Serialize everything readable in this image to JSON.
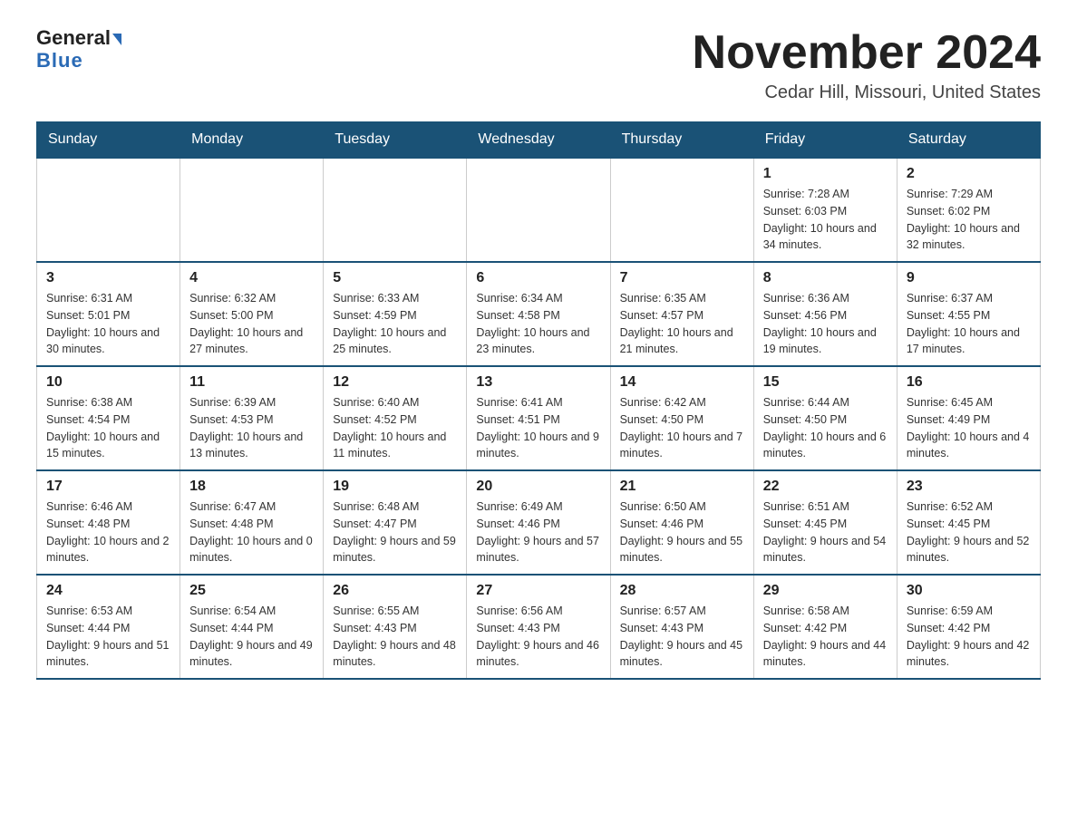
{
  "header": {
    "logo_line1": "General",
    "logo_line2": "Blue",
    "month_title": "November 2024",
    "location": "Cedar Hill, Missouri, United States"
  },
  "weekdays": [
    "Sunday",
    "Monday",
    "Tuesday",
    "Wednesday",
    "Thursday",
    "Friday",
    "Saturday"
  ],
  "weeks": [
    [
      {
        "day": "",
        "info": ""
      },
      {
        "day": "",
        "info": ""
      },
      {
        "day": "",
        "info": ""
      },
      {
        "day": "",
        "info": ""
      },
      {
        "day": "",
        "info": ""
      },
      {
        "day": "1",
        "info": "Sunrise: 7:28 AM\nSunset: 6:03 PM\nDaylight: 10 hours\nand 34 minutes."
      },
      {
        "day": "2",
        "info": "Sunrise: 7:29 AM\nSunset: 6:02 PM\nDaylight: 10 hours\nand 32 minutes."
      }
    ],
    [
      {
        "day": "3",
        "info": "Sunrise: 6:31 AM\nSunset: 5:01 PM\nDaylight: 10 hours\nand 30 minutes."
      },
      {
        "day": "4",
        "info": "Sunrise: 6:32 AM\nSunset: 5:00 PM\nDaylight: 10 hours\nand 27 minutes."
      },
      {
        "day": "5",
        "info": "Sunrise: 6:33 AM\nSunset: 4:59 PM\nDaylight: 10 hours\nand 25 minutes."
      },
      {
        "day": "6",
        "info": "Sunrise: 6:34 AM\nSunset: 4:58 PM\nDaylight: 10 hours\nand 23 minutes."
      },
      {
        "day": "7",
        "info": "Sunrise: 6:35 AM\nSunset: 4:57 PM\nDaylight: 10 hours\nand 21 minutes."
      },
      {
        "day": "8",
        "info": "Sunrise: 6:36 AM\nSunset: 4:56 PM\nDaylight: 10 hours\nand 19 minutes."
      },
      {
        "day": "9",
        "info": "Sunrise: 6:37 AM\nSunset: 4:55 PM\nDaylight: 10 hours\nand 17 minutes."
      }
    ],
    [
      {
        "day": "10",
        "info": "Sunrise: 6:38 AM\nSunset: 4:54 PM\nDaylight: 10 hours\nand 15 minutes."
      },
      {
        "day": "11",
        "info": "Sunrise: 6:39 AM\nSunset: 4:53 PM\nDaylight: 10 hours\nand 13 minutes."
      },
      {
        "day": "12",
        "info": "Sunrise: 6:40 AM\nSunset: 4:52 PM\nDaylight: 10 hours\nand 11 minutes."
      },
      {
        "day": "13",
        "info": "Sunrise: 6:41 AM\nSunset: 4:51 PM\nDaylight: 10 hours\nand 9 minutes."
      },
      {
        "day": "14",
        "info": "Sunrise: 6:42 AM\nSunset: 4:50 PM\nDaylight: 10 hours\nand 7 minutes."
      },
      {
        "day": "15",
        "info": "Sunrise: 6:44 AM\nSunset: 4:50 PM\nDaylight: 10 hours\nand 6 minutes."
      },
      {
        "day": "16",
        "info": "Sunrise: 6:45 AM\nSunset: 4:49 PM\nDaylight: 10 hours\nand 4 minutes."
      }
    ],
    [
      {
        "day": "17",
        "info": "Sunrise: 6:46 AM\nSunset: 4:48 PM\nDaylight: 10 hours\nand 2 minutes."
      },
      {
        "day": "18",
        "info": "Sunrise: 6:47 AM\nSunset: 4:48 PM\nDaylight: 10 hours\nand 0 minutes."
      },
      {
        "day": "19",
        "info": "Sunrise: 6:48 AM\nSunset: 4:47 PM\nDaylight: 9 hours\nand 59 minutes."
      },
      {
        "day": "20",
        "info": "Sunrise: 6:49 AM\nSunset: 4:46 PM\nDaylight: 9 hours\nand 57 minutes."
      },
      {
        "day": "21",
        "info": "Sunrise: 6:50 AM\nSunset: 4:46 PM\nDaylight: 9 hours\nand 55 minutes."
      },
      {
        "day": "22",
        "info": "Sunrise: 6:51 AM\nSunset: 4:45 PM\nDaylight: 9 hours\nand 54 minutes."
      },
      {
        "day": "23",
        "info": "Sunrise: 6:52 AM\nSunset: 4:45 PM\nDaylight: 9 hours\nand 52 minutes."
      }
    ],
    [
      {
        "day": "24",
        "info": "Sunrise: 6:53 AM\nSunset: 4:44 PM\nDaylight: 9 hours\nand 51 minutes."
      },
      {
        "day": "25",
        "info": "Sunrise: 6:54 AM\nSunset: 4:44 PM\nDaylight: 9 hours\nand 49 minutes."
      },
      {
        "day": "26",
        "info": "Sunrise: 6:55 AM\nSunset: 4:43 PM\nDaylight: 9 hours\nand 48 minutes."
      },
      {
        "day": "27",
        "info": "Sunrise: 6:56 AM\nSunset: 4:43 PM\nDaylight: 9 hours\nand 46 minutes."
      },
      {
        "day": "28",
        "info": "Sunrise: 6:57 AM\nSunset: 4:43 PM\nDaylight: 9 hours\nand 45 minutes."
      },
      {
        "day": "29",
        "info": "Sunrise: 6:58 AM\nSunset: 4:42 PM\nDaylight: 9 hours\nand 44 minutes."
      },
      {
        "day": "30",
        "info": "Sunrise: 6:59 AM\nSunset: 4:42 PM\nDaylight: 9 hours\nand 42 minutes."
      }
    ]
  ]
}
